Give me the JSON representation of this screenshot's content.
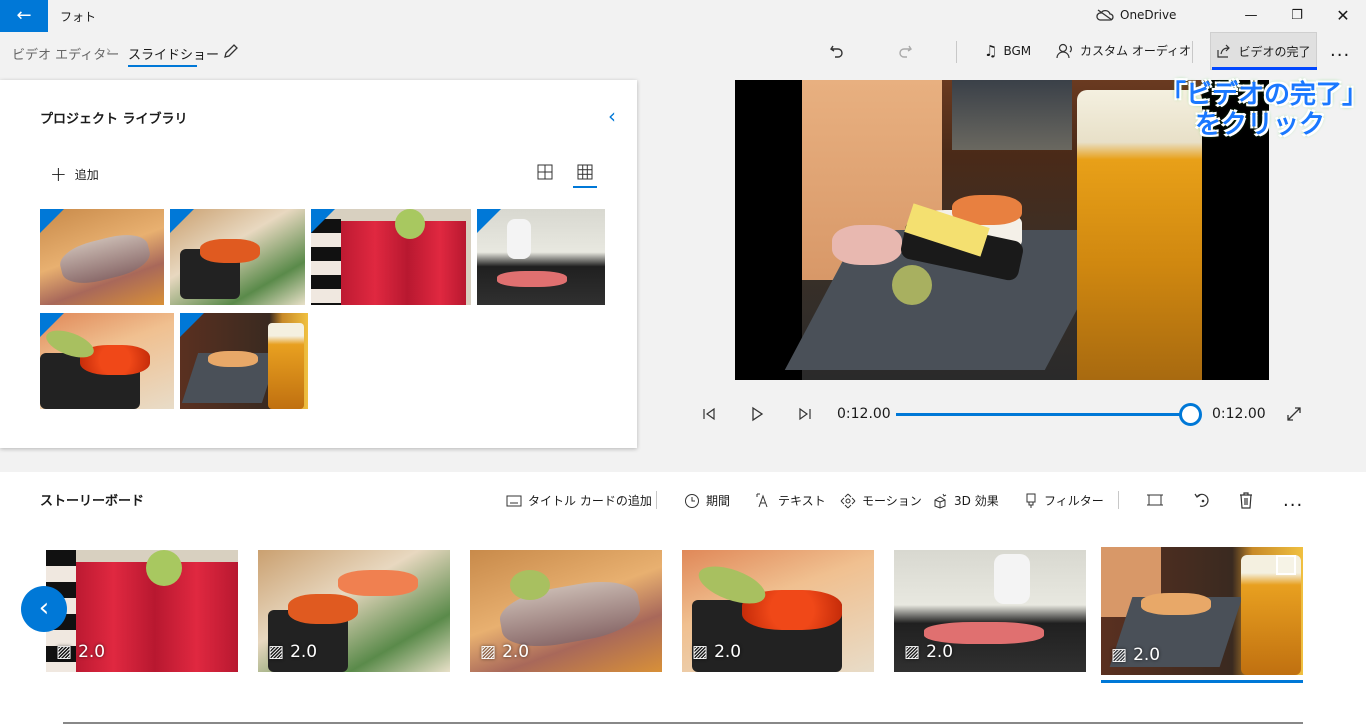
{
  "app": {
    "title": "フォト",
    "onedrive": "OneDrive"
  },
  "breadcrumb": {
    "parent": "ビデオ エディター",
    "current": "スライドショー"
  },
  "commands": {
    "bgm": "BGM",
    "custom_audio": "カスタム オーディオ",
    "finish": "ビデオの完了",
    "more": "..."
  },
  "library": {
    "title": "プロジェクト ライブラリ",
    "add": "追加"
  },
  "annotation": {
    "line1": "「ビデオの完了」",
    "line2": "をクリック"
  },
  "player": {
    "current_time": "0:12.00",
    "end_time": "0:12.00",
    "progress": 1.0
  },
  "storyboard": {
    "title": "ストーリーボード",
    "tools": {
      "title_card": "タイトル カードの追加",
      "duration": "期間",
      "text": "テキスト",
      "motion": "モーション",
      "effects3d": "3D 効果",
      "filter": "フィルター"
    },
    "cards": [
      {
        "duration": "2.0"
      },
      {
        "duration": "2.0"
      },
      {
        "duration": "2.0"
      },
      {
        "duration": "2.0"
      },
      {
        "duration": "2.0"
      },
      {
        "duration": "2.0"
      }
    ]
  },
  "colors": {
    "accent": "#0078d7",
    "annotation": "#1a78ff"
  }
}
